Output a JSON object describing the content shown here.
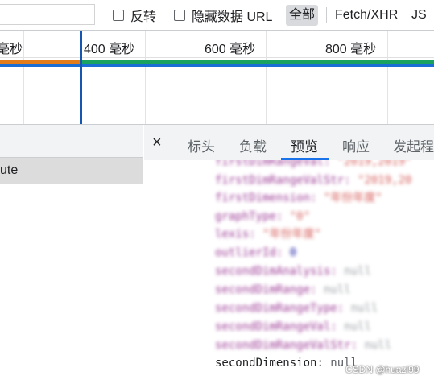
{
  "toolbar": {
    "invert_label": "反转",
    "hide_data_urls_label": "隐藏数据 URL",
    "filters": [
      "全部",
      "Fetch/XHR",
      "JS"
    ]
  },
  "timeline": {
    "ticks": [
      "毫秒",
      "400 毫秒",
      "600 毫秒",
      "800 毫秒"
    ]
  },
  "request_list": {
    "selected_row": "ute"
  },
  "detail_tabs": {
    "close": "×",
    "tabs": [
      "标头",
      "负载",
      "预览",
      "响应",
      "发起程"
    ],
    "active": "预览"
  },
  "preview": {
    "lines": [
      {
        "key": "firstDimRangeVal",
        "value": "\"2019,2019\"",
        "kind": "str"
      },
      {
        "key": "firstDimRangeValStr",
        "value": "\"2019,20",
        "kind": "str"
      },
      {
        "key": "firstDimension",
        "value": "\"年份年度\"",
        "kind": "str"
      },
      {
        "key": "graphType",
        "value": "\"0\"",
        "kind": "str"
      },
      {
        "key": "lexis",
        "value": "\"年份年度\"",
        "kind": "str"
      },
      {
        "key": "outlierId",
        "value": "0",
        "kind": "num"
      },
      {
        "key": "secondDimAnalysis",
        "value": "null",
        "kind": "null"
      },
      {
        "key": "secondDimRange",
        "value": "null",
        "kind": "null"
      },
      {
        "key": "secondDimRangeType",
        "value": "null",
        "kind": "null"
      },
      {
        "key": "secondDimRangeVal",
        "value": "null",
        "kind": "null"
      },
      {
        "key": "secondDimRangeValStr",
        "value": "null",
        "kind": "null"
      },
      {
        "key": "secondDimension",
        "value": "null",
        "kind": "clear"
      }
    ]
  },
  "watermark": "CSDN @huazi99"
}
